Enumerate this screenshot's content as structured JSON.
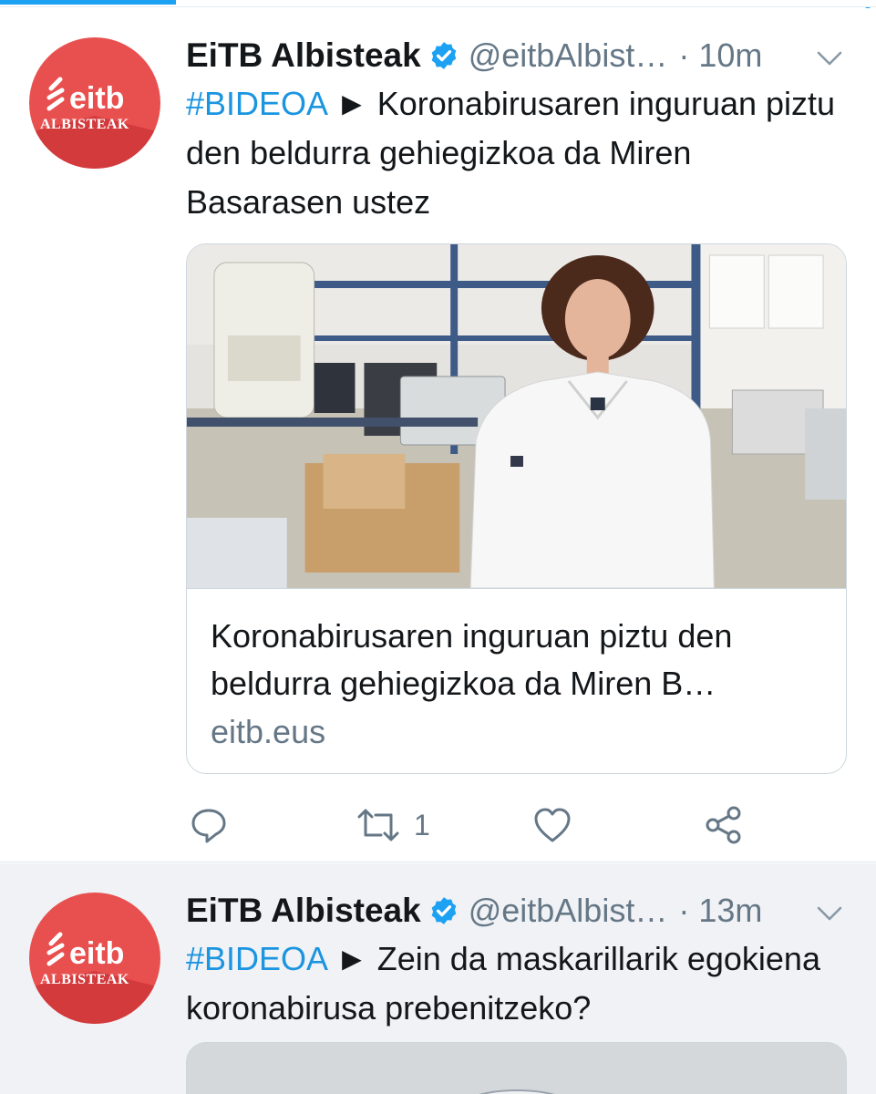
{
  "colors": {
    "accent": "#1da1f2",
    "hashtag": "#1b95e0",
    "secondary_text": "#657786",
    "avatar_red": "#e8504f"
  },
  "tweets": [
    {
      "author_name": "EiTB Albisteak",
      "author_handle": "@eitbAlbist…",
      "separator": "·",
      "time": "10m",
      "hashtag": "#BIDEOA",
      "arrow": "►",
      "text": "Koronabirusaren inguruan piztu den beldurra gehiegizkoa da Miren Basarasen ustez",
      "card": {
        "title": "Koronabirusaren inguruan piztu den beldurra gehiegizkoa da Miren B…",
        "domain": "eitb.eus"
      },
      "retweet_count": "1"
    },
    {
      "author_name": "EiTB Albisteak",
      "author_handle": "@eitbAlbist…",
      "separator": "·",
      "time": "13m",
      "hashtag": "#BIDEOA",
      "arrow": "►",
      "text": "Zein da maskarillarik egokiena koronabirusa prebenitzeko?"
    }
  ],
  "avatar": {
    "logo_text": "eitb",
    "sub_text": "ALBISTEAK"
  },
  "icons": [
    "verified-icon",
    "chevron-down-icon",
    "reply-icon",
    "retweet-icon",
    "like-icon",
    "share-icon"
  ]
}
